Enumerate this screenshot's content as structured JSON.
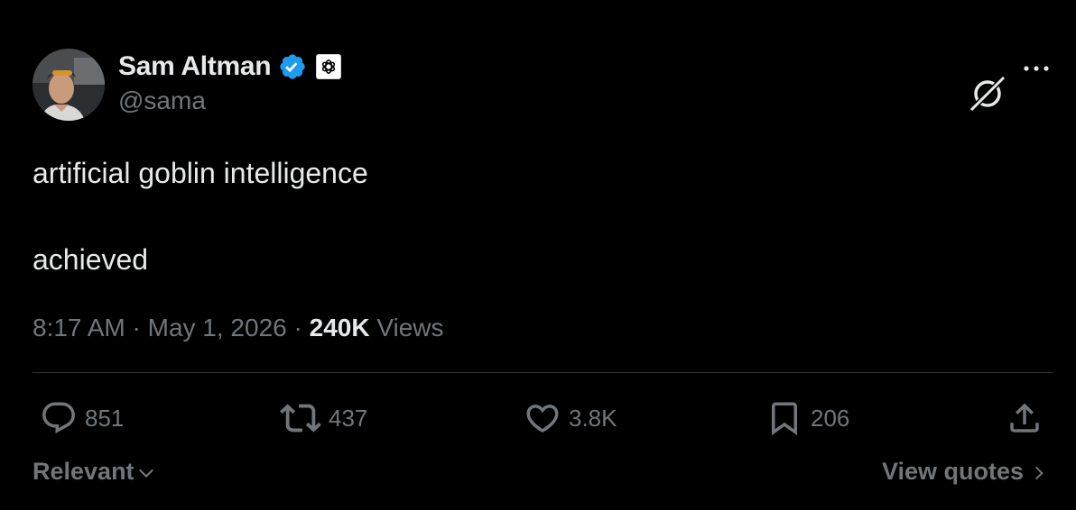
{
  "author": {
    "display_name": "Sam Altman",
    "handle": "@sama",
    "verified": true,
    "avatar_icon": "user-avatar",
    "affiliate_icon": "openai-logo-icon"
  },
  "tweet": {
    "lines": [
      "artificial goblin intelligence",
      "achieved"
    ]
  },
  "meta": {
    "time": "8:17 AM",
    "separator": "·",
    "date": "May 1, 2026",
    "views_count": "240K",
    "views_label": "Views"
  },
  "actions": {
    "replies": "851",
    "reposts": "437",
    "likes": "3.8K",
    "bookmarks": "206"
  },
  "footer": {
    "sort_label": "Relevant",
    "quotes_label": "View quotes"
  },
  "colors": {
    "background": "#000000",
    "text_primary": "#e7e9ea",
    "text_secondary": "#71767b",
    "verified_blue": "#1d9bf0",
    "divider": "#2f3336"
  }
}
